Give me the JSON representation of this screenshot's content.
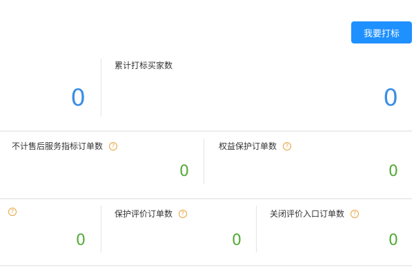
{
  "header": {
    "mark_button_label": "我要打标"
  },
  "row1": [
    {
      "label": "",
      "value": "0"
    },
    {
      "label": "累计打标买家数",
      "value": "0"
    }
  ],
  "row2": [
    {
      "label": "不计售后服务指标订单数",
      "value": "0"
    },
    {
      "label": "权益保护订单数",
      "value": "0"
    }
  ],
  "row3": [
    {
      "label": "",
      "value": "0"
    },
    {
      "label": "保护评价订单数",
      "value": "0"
    },
    {
      "label": "关闭评价入口订单数",
      "value": "0"
    }
  ],
  "help_glyph": "?",
  "icons": {
    "help": "question-circle-icon"
  },
  "colors": {
    "primary": "#1e90ff",
    "blue_value": "#3a8ee6",
    "green_value": "#52a936",
    "help_icon": "#e6a23c"
  }
}
